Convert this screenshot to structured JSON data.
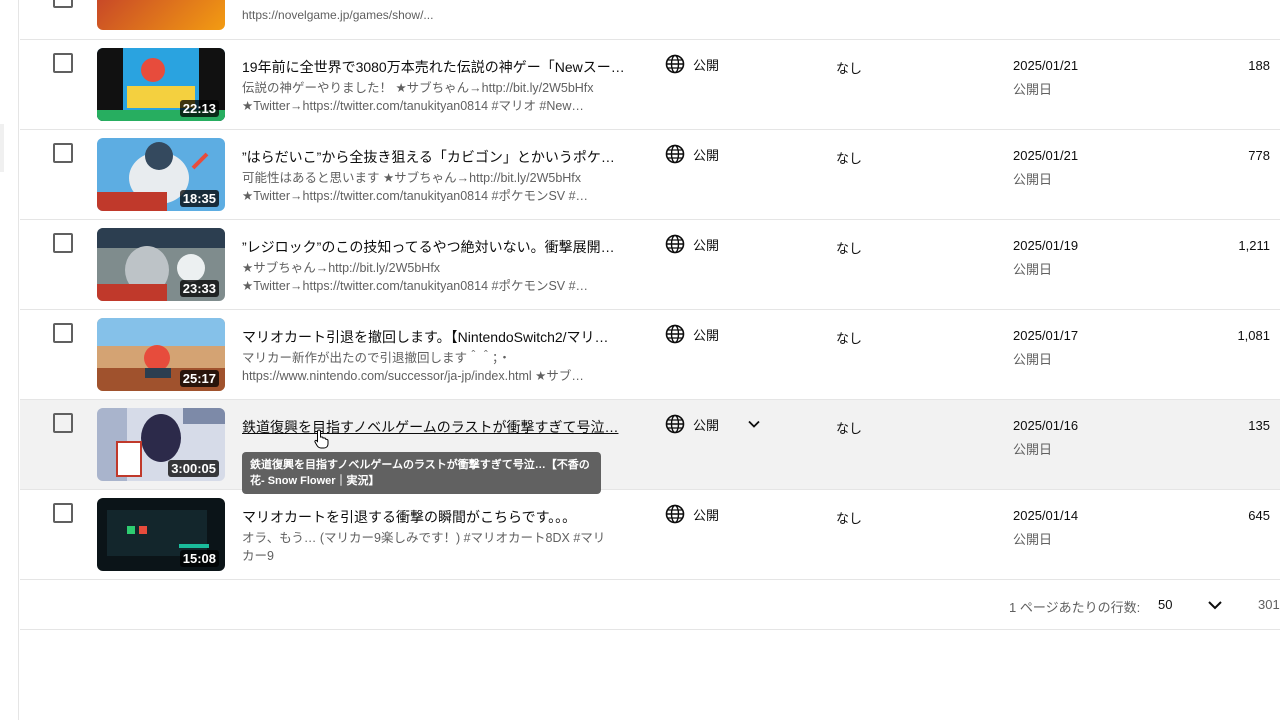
{
  "top_partial_row": {
    "desc_fragment": "https://novelgame.jp/games/show/..."
  },
  "rows": [
    {
      "title": "19年前に全世界で3080万本売れた伝説の神ゲー「Newスー…",
      "desc1": "伝説の神ゲーやりました！ ★サブちゃん→http://bit.ly/2W5bHfx",
      "desc2": "★Twitter→https://twitter.com/tanukityan0814 #マリオ #New…",
      "duration": "22:13",
      "visibility": "公開",
      "restrictions": "なし",
      "date": "2025/01/21",
      "date_label": "公開日",
      "views": "188"
    },
    {
      "title": "”はらだいこ”から全抜き狙える「カビゴン」とかいうポケ…",
      "desc1": "可能性はあると思います ★サブちゃん→http://bit.ly/2W5bHfx",
      "desc2": "★Twitter→https://twitter.com/tanukityan0814 #ポケモンSV #…",
      "duration": "18:35",
      "visibility": "公開",
      "restrictions": "なし",
      "date": "2025/01/21",
      "date_label": "公開日",
      "views": "778"
    },
    {
      "title": "”レジロック”のこの技知ってるやつ絶対いない。衝撃展開…",
      "desc1": "★サブちゃん→http://bit.ly/2W5bHfx",
      "desc2": "★Twitter→https://twitter.com/tanukityan0814 #ポケモンSV #…",
      "duration": "23:33",
      "visibility": "公開",
      "restrictions": "なし",
      "date": "2025/01/19",
      "date_label": "公開日",
      "views": "1,211"
    },
    {
      "title": "マリオカート引退を撤回します。【NintendoSwitch2/マリ…",
      "desc1": "マリカー新作が出たので引退撤回します＾＾；・",
      "desc2": "https://www.nintendo.com/successor/ja-jp/index.html ★サブ…",
      "duration": "25:17",
      "visibility": "公開",
      "restrictions": "なし",
      "date": "2025/01/17",
      "date_label": "公開日",
      "views": "1,081"
    },
    {
      "title": "鉄道復興を目指すノベルゲームのラストが衝撃すぎて号泣…",
      "desc1": "",
      "desc2": "",
      "duration": "3:00:05",
      "visibility": "公開",
      "restrictions": "なし",
      "date": "2025/01/16",
      "date_label": "公開日",
      "views": "135",
      "tooltip": "鉄道復興を目指すノベルゲームのラストが衝撃すぎて号泣…【不香の花- Snow Flower｜実況】"
    },
    {
      "title": "マリオカートを引退する衝撃の瞬間がこちらです。。。",
      "desc1": "オラ、もう… (マリカー9楽しみです！) #マリオカート8DX #マリ",
      "desc2": "カー9",
      "duration": "15:08",
      "visibility": "公開",
      "restrictions": "なし",
      "date": "2025/01/14",
      "date_label": "公開日",
      "views": "645"
    }
  ],
  "footer": {
    "rows_per_page_label": "1 ページあたりの行数:",
    "rows_per_page_value": "50",
    "range_text": "301"
  },
  "colors": {
    "divider": "#e5e5e5",
    "hover_row": "#f2f2f2",
    "secondary_text": "#606060",
    "tooltip_bg": "#616161"
  }
}
